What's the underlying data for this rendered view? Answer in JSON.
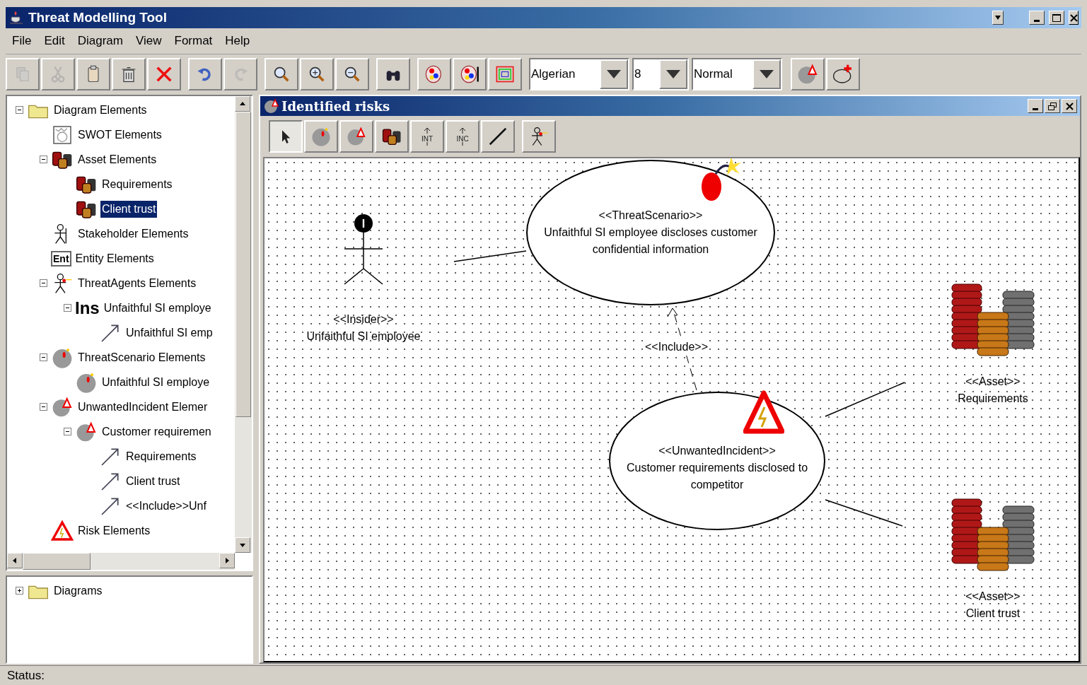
{
  "window": {
    "title": "Threat Modelling Tool"
  },
  "menu": [
    "File",
    "Edit",
    "Diagram",
    "View",
    "Format",
    "Help"
  ],
  "toolbar": [
    {
      "buttons": [
        {
          "kind": "copy",
          "disabled": true
        },
        {
          "kind": "cut",
          "disabled": true
        },
        {
          "kind": "paste",
          "disabled": false
        },
        {
          "kind": "trash",
          "disabled": false
        },
        {
          "kind": "delete",
          "disabled": false
        }
      ]
    },
    {
      "buttons": [
        {
          "kind": "undo",
          "disabled": false
        },
        {
          "kind": "redo",
          "disabled": true
        }
      ]
    },
    {
      "buttons": [
        {
          "kind": "search",
          "disabled": false
        },
        {
          "kind": "zoomin",
          "disabled": false
        },
        {
          "kind": "zoomout",
          "disabled": false
        }
      ]
    },
    {
      "buttons": [
        {
          "kind": "binoculars",
          "disabled": false
        }
      ]
    },
    {
      "buttons": [
        {
          "kind": "palette",
          "disabled": false
        },
        {
          "kind": "palettebar",
          "disabled": false
        },
        {
          "kind": "frame",
          "disabled": false
        }
      ]
    }
  ],
  "font_controls": [
    {
      "value": "Algerian"
    },
    {
      "value": "8"
    },
    {
      "value": "Normal"
    }
  ],
  "toolbar_end": [
    {
      "kind": "incident"
    },
    {
      "kind": "ellipseplus"
    }
  ],
  "element_tree": {
    "label": "Diagram Elements",
    "kind": "folder",
    "expanded": true,
    "selected": false,
    "children": [
      {
        "label": "SWOT Elements",
        "kind": "swot",
        "selected": false
      },
      {
        "label": "Asset Elements",
        "kind": "asset",
        "expanded": true,
        "selected": false,
        "children": [
          {
            "label": "Requirements",
            "kind": "asset",
            "selected": false
          },
          {
            "label": "Client trust",
            "kind": "asset",
            "selected": true
          }
        ]
      },
      {
        "label": "Stakeholder Elements",
        "kind": "stakeholder",
        "selected": false
      },
      {
        "label": "Entity Elements",
        "kind": "entity",
        "icon_text": "Ent",
        "selected": false
      },
      {
        "label": "ThreatAgents Elements",
        "kind": "agent",
        "expanded": true,
        "selected": false,
        "children": [
          {
            "label": "Unfaithful SI employe",
            "kind": "insider",
            "icon_text": "Ins",
            "expanded": true,
            "selected": false,
            "children": [
              {
                "label": "Unfaithful SI emp",
                "kind": "relation",
                "selected": false
              }
            ]
          }
        ]
      },
      {
        "label": "ThreatScenario Elements",
        "kind": "scenario",
        "expanded": true,
        "selected": false,
        "children": [
          {
            "label": "Unfaithful SI employe",
            "kind": "scenario",
            "selected": false
          }
        ]
      },
      {
        "label": "UnwantedIncident Elemer",
        "kind": "incident",
        "expanded": true,
        "selected": false,
        "children": [
          {
            "label": "Customer requiremen",
            "kind": "incident",
            "expanded": true,
            "selected": false,
            "children": [
              {
                "label": "Requirements",
                "kind": "relation",
                "selected": false
              },
              {
                "label": "Client trust",
                "kind": "relation",
                "selected": false
              },
              {
                "label": "<<Include>>Unf",
                "kind": "relation",
                "selected": false
              }
            ]
          }
        ]
      },
      {
        "label": "Risk Elements",
        "kind": "risk",
        "selected": false
      }
    ]
  },
  "diagram_tree": {
    "label": "Diagrams",
    "kind": "folder",
    "expanded": false,
    "selected": false
  },
  "diagram_window": {
    "title": "Identified risks",
    "tools": [
      {
        "kind": "select",
        "selected": true
      },
      {
        "kind": "scenario",
        "selected": false
      },
      {
        "kind": "incident",
        "selected": false
      },
      {
        "kind": "asset",
        "selected": false
      },
      {
        "kind": "int",
        "label": "INT",
        "selected": false
      },
      {
        "kind": "inc",
        "label": "INC",
        "selected": false
      },
      {
        "kind": "line",
        "selected": false
      },
      {
        "kind": "agent",
        "selected": false
      }
    ],
    "nodes": [
      {
        "kind": "actor",
        "icon_text": "I",
        "stereotype": "<<Insider>>",
        "name": "Unfaithful SI employee"
      },
      {
        "kind": "scenario",
        "stereotype": "<<ThreatScenario>>",
        "name": "Unfaithful SI employee discloses customer confidential information"
      },
      {
        "kind": "incident",
        "stereotype": "<<UnwantedIncident>>",
        "name": "Customer requirements disclosed to competitor"
      },
      {
        "kind": "asset",
        "stereotype": "<<Asset>>",
        "name": "Requirements"
      },
      {
        "kind": "asset",
        "stereotype": "<<Asset>>",
        "name": "Client trust"
      }
    ],
    "include_label": "<<Include>>"
  },
  "status_bar": "Status:"
}
